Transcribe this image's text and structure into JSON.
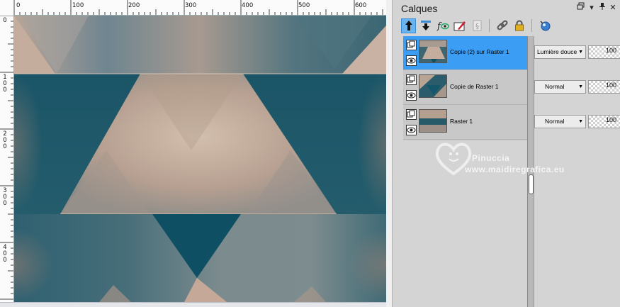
{
  "canvas": {
    "ruler_h_labels": [
      "0",
      "100",
      "200",
      "300",
      "400",
      "500",
      "600"
    ],
    "ruler_v_labels": [
      "0",
      "1\n0\n0",
      "2\n0\n0",
      "3\n0\n0",
      "4\n0\n0"
    ],
    "colors": {
      "teal_dark": "#0f4d60",
      "teal": "#3c6e7c",
      "beige": "#c8b2a0",
      "rose_tan": "#b08876",
      "grey_blue": "#8a9ea4"
    }
  },
  "layers_panel": {
    "title": "Calques",
    "title_buttons": [
      "restore-icon",
      "dropdown-icon",
      "pin-icon",
      "close-icon"
    ],
    "toolbar": [
      "move-up-icon",
      "move-down-icon",
      "visibility-icon",
      "paint-layer-icon",
      "mask-icon",
      "link-icon",
      "lock-icon",
      "palette-icon"
    ],
    "layers": [
      {
        "name": "Copie (2) sur Raster 1",
        "blend": "Lumière douce",
        "opacity": "100",
        "selected": true
      },
      {
        "name": "Copie de Raster 1",
        "blend": "Normal",
        "opacity": "100",
        "selected": false
      },
      {
        "name": "Raster 1",
        "blend": "Normal",
        "opacity": "100",
        "selected": false
      }
    ],
    "accent_color": "#3c9df4"
  },
  "watermark": {
    "line1": "Pinuccia",
    "line2": "www.maidiregrafica.eu"
  }
}
